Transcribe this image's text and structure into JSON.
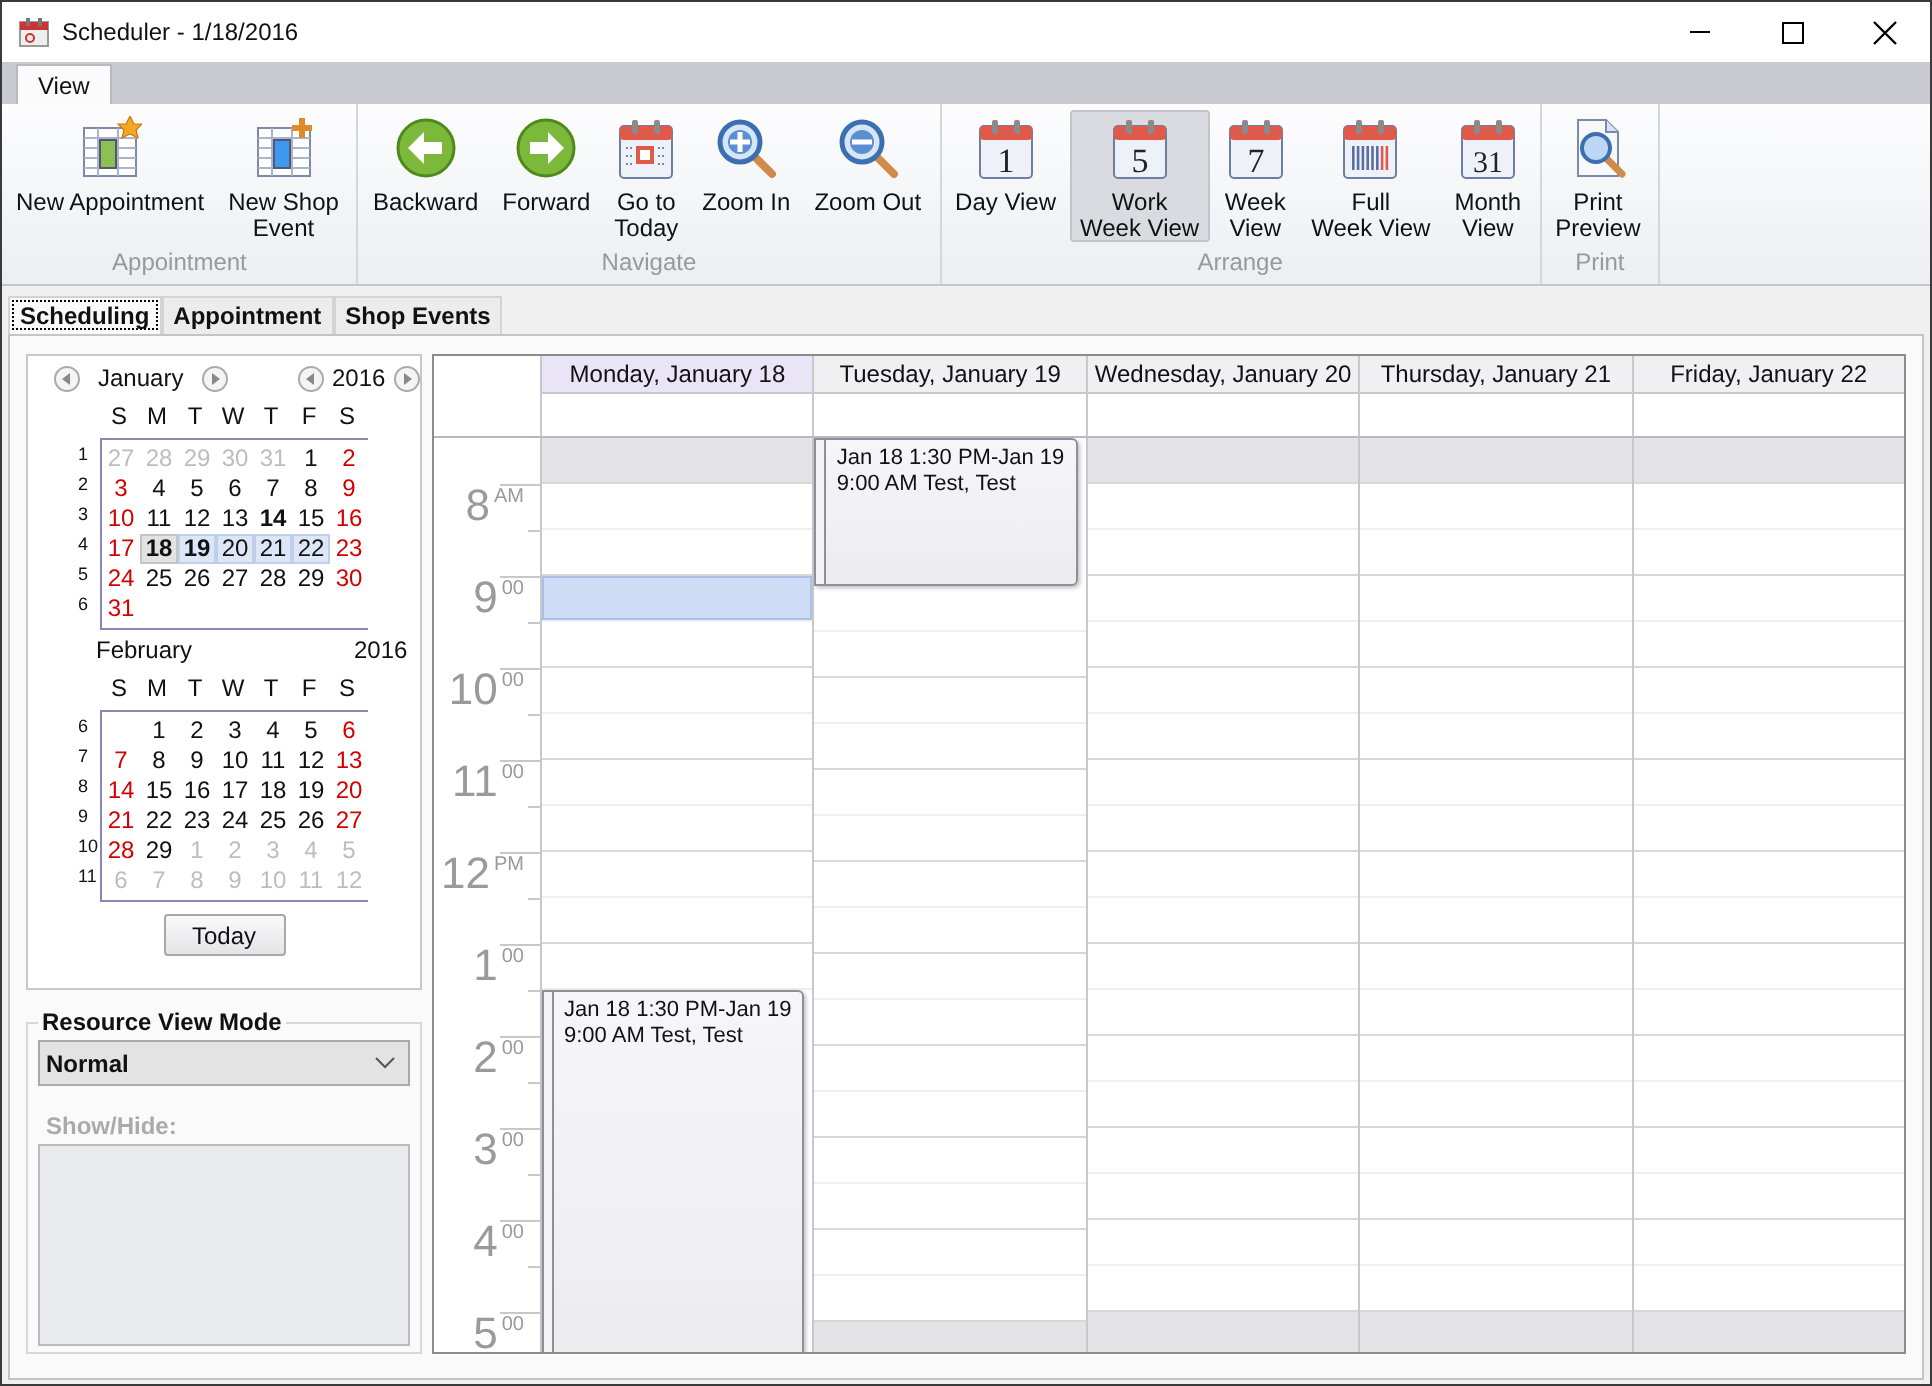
{
  "window": {
    "title": "Scheduler - 1/18/2016"
  },
  "ribbon": {
    "tabs": [
      {
        "label": "View",
        "selected": true
      }
    ],
    "groups": [
      {
        "label": "Appointment",
        "buttons": [
          {
            "label": "New Appointment",
            "kind": "appointment",
            "selected": false
          },
          {
            "label": "New Shop\nEvent",
            "kind": "event",
            "selected": false
          }
        ]
      },
      {
        "label": "Navigate",
        "buttons": [
          {
            "label": "Backward",
            "kind": "backward",
            "selected": false
          },
          {
            "label": "Forward",
            "kind": "forward",
            "selected": false
          },
          {
            "label": "Go to\nToday",
            "kind": "today",
            "selected": false
          },
          {
            "label": "Zoom In",
            "kind": "zoomin",
            "selected": false
          },
          {
            "label": "Zoom Out",
            "kind": "zoomout",
            "selected": false
          }
        ]
      },
      {
        "label": "Arrange",
        "buttons": [
          {
            "label": "Day View",
            "kind": "calendar",
            "icon_text": "1",
            "selected": false
          },
          {
            "label": "Work\nWeek View",
            "kind": "calendar",
            "icon_text": "5",
            "selected": true
          },
          {
            "label": "Week\nView",
            "kind": "calendar",
            "icon_text": "7",
            "selected": false
          },
          {
            "label": "Full\nWeek View",
            "kind": "fullweek",
            "selected": false
          },
          {
            "label": "Month\nView",
            "kind": "calendar",
            "icon_text": "31",
            "selected": false
          }
        ]
      },
      {
        "label": "Print",
        "buttons": [
          {
            "label": "Print\nPreview",
            "kind": "preview",
            "selected": false
          }
        ]
      }
    ]
  },
  "tabs": [
    {
      "label": "Scheduling",
      "selected": true
    },
    {
      "label": "Appointment",
      "selected": false
    },
    {
      "label": "Shop Events",
      "selected": false
    }
  ],
  "calendar": {
    "months": [
      {
        "month": "January",
        "year": "2016",
        "weekdays": [
          "S",
          "M",
          "T",
          "W",
          "T",
          "F",
          "S"
        ],
        "weeks": [
          {
            "number": "1",
            "days": [
              {
                "day": "27",
                "muted": true,
                "bold": false,
                "selected": false,
                "today": false
              },
              {
                "day": "28",
                "muted": true,
                "bold": false,
                "selected": false,
                "today": false
              },
              {
                "day": "29",
                "muted": true,
                "bold": false,
                "selected": false,
                "today": false
              },
              {
                "day": "30",
                "muted": true,
                "bold": false,
                "selected": false,
                "today": false
              },
              {
                "day": "31",
                "muted": true,
                "bold": false,
                "selected": false,
                "today": false
              },
              {
                "day": "1",
                "muted": false,
                "bold": false,
                "selected": false,
                "today": false
              },
              {
                "day": "2",
                "muted": false,
                "bold": false,
                "selected": false,
                "today": false
              }
            ]
          },
          {
            "number": "2",
            "days": [
              {
                "day": "3",
                "muted": false,
                "bold": false,
                "selected": false,
                "today": false
              },
              {
                "day": "4",
                "muted": false,
                "bold": false,
                "selected": false,
                "today": false
              },
              {
                "day": "5",
                "muted": false,
                "bold": false,
                "selected": false,
                "today": false
              },
              {
                "day": "6",
                "muted": false,
                "bold": false,
                "selected": false,
                "today": false
              },
              {
                "day": "7",
                "muted": false,
                "bold": false,
                "selected": false,
                "today": false
              },
              {
                "day": "8",
                "muted": false,
                "bold": false,
                "selected": false,
                "today": false
              },
              {
                "day": "9",
                "muted": false,
                "bold": false,
                "selected": false,
                "today": false
              }
            ]
          },
          {
            "number": "3",
            "days": [
              {
                "day": "10",
                "muted": false,
                "bold": false,
                "selected": false,
                "today": false
              },
              {
                "day": "11",
                "muted": false,
                "bold": false,
                "selected": false,
                "today": false
              },
              {
                "day": "12",
                "muted": false,
                "bold": false,
                "selected": false,
                "today": false
              },
              {
                "day": "13",
                "muted": false,
                "bold": false,
                "selected": false,
                "today": false
              },
              {
                "day": "14",
                "muted": false,
                "bold": true,
                "selected": false,
                "today": false
              },
              {
                "day": "15",
                "muted": false,
                "bold": false,
                "selected": false,
                "today": false
              },
              {
                "day": "16",
                "muted": false,
                "bold": false,
                "selected": false,
                "today": false
              }
            ]
          },
          {
            "number": "4",
            "days": [
              {
                "day": "17",
                "muted": false,
                "bold": false,
                "selected": false,
                "today": false
              },
              {
                "day": "18",
                "muted": false,
                "bold": true,
                "selected": true,
                "today": true
              },
              {
                "day": "19",
                "muted": false,
                "bold": true,
                "selected": true,
                "today": false
              },
              {
                "day": "20",
                "muted": false,
                "bold": false,
                "selected": true,
                "today": false
              },
              {
                "day": "21",
                "muted": false,
                "bold": false,
                "selected": true,
                "today": false
              },
              {
                "day": "22",
                "muted": false,
                "bold": false,
                "selected": true,
                "today": false
              },
              {
                "day": "23",
                "muted": false,
                "bold": false,
                "selected": false,
                "today": false
              }
            ]
          },
          {
            "number": "5",
            "days": [
              {
                "day": "24",
                "muted": false,
                "bold": false,
                "selected": false,
                "today": false
              },
              {
                "day": "25",
                "muted": false,
                "bold": false,
                "selected": false,
                "today": false
              },
              {
                "day": "26",
                "muted": false,
                "bold": false,
                "selected": false,
                "today": false
              },
              {
                "day": "27",
                "muted": false,
                "bold": false,
                "selected": false,
                "today": false
              },
              {
                "day": "28",
                "muted": false,
                "bold": false,
                "selected": false,
                "today": false
              },
              {
                "day": "29",
                "muted": false,
                "bold": false,
                "selected": false,
                "today": false
              },
              {
                "day": "30",
                "muted": false,
                "bold": false,
                "selected": false,
                "today": false
              }
            ]
          },
          {
            "number": "6",
            "days": [
              {
                "day": "31",
                "muted": false,
                "bold": false,
                "selected": false,
                "today": false
              }
            ]
          }
        ]
      },
      {
        "month": "February",
        "year": "2016",
        "weekdays": [
          "S",
          "M",
          "T",
          "W",
          "T",
          "F",
          "S"
        ],
        "weeks": [
          {
            "number": "6",
            "days": [
              {
                "day": "1",
                "muted": false,
                "bold": false,
                "selected": false,
                "today": false
              },
              {
                "day": "2",
                "muted": false,
                "bold": false,
                "selected": false,
                "today": false
              },
              {
                "day": "3",
                "muted": false,
                "bold": false,
                "selected": false,
                "today": false
              },
              {
                "day": "4",
                "muted": false,
                "bold": false,
                "selected": false,
                "today": false
              },
              {
                "day": "5",
                "muted": false,
                "bold": false,
                "selected": false,
                "today": false
              },
              {
                "day": "6",
                "muted": false,
                "bold": false,
                "selected": false,
                "today": false
              }
            ]
          },
          {
            "number": "7",
            "days": [
              {
                "day": "7",
                "muted": false,
                "bold": false,
                "selected": false,
                "today": false
              },
              {
                "day": "8",
                "muted": false,
                "bold": false,
                "selected": false,
                "today": false
              },
              {
                "day": "9",
                "muted": false,
                "bold": false,
                "selected": false,
                "today": false
              },
              {
                "day": "10",
                "muted": false,
                "bold": false,
                "selected": false,
                "today": false
              },
              {
                "day": "11",
                "muted": false,
                "bold": false,
                "selected": false,
                "today": false
              },
              {
                "day": "12",
                "muted": false,
                "bold": false,
                "selected": false,
                "today": false
              },
              {
                "day": "13",
                "muted": false,
                "bold": false,
                "selected": false,
                "today": false
              }
            ]
          },
          {
            "number": "8",
            "days": [
              {
                "day": "14",
                "muted": false,
                "bold": false,
                "selected": false,
                "today": false
              },
              {
                "day": "15",
                "muted": false,
                "bold": false,
                "selected": false,
                "today": false
              },
              {
                "day": "16",
                "muted": false,
                "bold": false,
                "selected": false,
                "today": false
              },
              {
                "day": "17",
                "muted": false,
                "bold": false,
                "selected": false,
                "today": false
              },
              {
                "day": "18",
                "muted": false,
                "bold": false,
                "selected": false,
                "today": false
              },
              {
                "day": "19",
                "muted": false,
                "bold": false,
                "selected": false,
                "today": false
              },
              {
                "day": "20",
                "muted": false,
                "bold": false,
                "selected": false,
                "today": false
              }
            ]
          },
          {
            "number": "9",
            "days": [
              {
                "day": "21",
                "muted": false,
                "bold": false,
                "selected": false,
                "today": false
              },
              {
                "day": "22",
                "muted": false,
                "bold": false,
                "selected": false,
                "today": false
              },
              {
                "day": "23",
                "muted": false,
                "bold": false,
                "selected": false,
                "today": false
              },
              {
                "day": "24",
                "muted": false,
                "bold": false,
                "selected": false,
                "today": false
              },
              {
                "day": "25",
                "muted": false,
                "bold": false,
                "selected": false,
                "today": false
              },
              {
                "day": "26",
                "muted": false,
                "bold": false,
                "selected": false,
                "today": false
              },
              {
                "day": "27",
                "muted": false,
                "bold": false,
                "selected": false,
                "today": false
              }
            ]
          },
          {
            "number": "10",
            "days": [
              {
                "day": "28",
                "muted": false,
                "bold": false,
                "selected": false,
                "today": false
              },
              {
                "day": "29",
                "muted": false,
                "bold": false,
                "selected": false,
                "today": false
              },
              {
                "day": "1",
                "muted": true,
                "bold": false,
                "selected": false,
                "today": false
              },
              {
                "day": "2",
                "muted": true,
                "bold": false,
                "selected": false,
                "today": false
              },
              {
                "day": "3",
                "muted": true,
                "bold": false,
                "selected": false,
                "today": false
              },
              {
                "day": "4",
                "muted": true,
                "bold": false,
                "selected": false,
                "today": false
              },
              {
                "day": "5",
                "muted": true,
                "bold": false,
                "selected": false,
                "today": false
              }
            ]
          },
          {
            "number": "11",
            "days": [
              {
                "day": "6",
                "muted": true,
                "bold": false,
                "selected": false,
                "today": false
              },
              {
                "day": "7",
                "muted": true,
                "bold": false,
                "selected": false,
                "today": false
              },
              {
                "day": "8",
                "muted": true,
                "bold": false,
                "selected": false,
                "today": false
              },
              {
                "day": "9",
                "muted": true,
                "bold": false,
                "selected": false,
                "today": false
              },
              {
                "day": "10",
                "muted": true,
                "bold": false,
                "selected": false,
                "today": false
              },
              {
                "day": "11",
                "muted": true,
                "bold": false,
                "selected": false,
                "today": false
              },
              {
                "day": "12",
                "muted": true,
                "bold": false,
                "selected": false,
                "today": false
              }
            ]
          }
        ]
      }
    ],
    "today_button": "Today"
  },
  "resource": {
    "title": "Resource View Mode",
    "value": "Normal",
    "show_hide_label": "Show/Hide:",
    "show_hide_disabled": true
  },
  "scheduler": {
    "rows": [
      {
        "working": false
      },
      {
        "working": true
      },
      {
        "working": true
      },
      {
        "working": true
      },
      {
        "working": true
      },
      {
        "working": true
      },
      {
        "working": true
      },
      {
        "working": true
      },
      {
        "working": true
      },
      {
        "working": true
      },
      {
        "working": true
      },
      {
        "working": true
      },
      {
        "working": true
      },
      {
        "working": true
      },
      {
        "working": true
      },
      {
        "working": true
      },
      {
        "working": true
      },
      {
        "working": true
      },
      {
        "working": true
      },
      {
        "working": false
      }
    ],
    "time_labels": [
      {
        "hour": "8",
        "suffix": "AM"
      },
      {
        "hour": "9",
        "suffix": "00"
      },
      {
        "hour": "10",
        "suffix": "00"
      },
      {
        "hour": "11",
        "suffix": "00"
      },
      {
        "hour": "12",
        "suffix": "PM"
      },
      {
        "hour": "1",
        "suffix": "00"
      },
      {
        "hour": "2",
        "suffix": "00"
      },
      {
        "hour": "3",
        "suffix": "00"
      },
      {
        "hour": "4",
        "suffix": "00"
      },
      {
        "hour": "5",
        "suffix": "00"
      }
    ],
    "days": [
      {
        "label": "Monday, January 18",
        "selected": true,
        "appointment": "Jan 18 1:30 PM-Jan 19 9:00 AM Test, Test",
        "slots": [
          {
            "kind": "free",
            "selected": false
          },
          {
            "kind": "free",
            "selected": false
          },
          {
            "kind": "free",
            "selected": false
          },
          {
            "kind": "free",
            "selected": true
          },
          {
            "kind": "free",
            "selected": false
          },
          {
            "kind": "free",
            "selected": false
          },
          {
            "kind": "free",
            "selected": false
          },
          {
            "kind": "free",
            "selected": false
          },
          {
            "kind": "free",
            "selected": false
          },
          {
            "kind": "free",
            "selected": false
          },
          {
            "kind": "free",
            "selected": false
          },
          {
            "kind": "free",
            "selected": false
          },
          {
            "kind": "busy"
          },
          {
            "kind": "busy"
          },
          {
            "kind": "busy"
          },
          {
            "kind": "busy"
          },
          {
            "kind": "busy"
          },
          {
            "kind": "busy"
          },
          {
            "kind": "busy"
          },
          {
            "kind": "busy"
          }
        ]
      },
      {
        "label": "Tuesday, January 19",
        "selected": false,
        "appointment": "Jan 18 1:30 PM-Jan 19 9:00 AM Test, Test",
        "slots": [
          {
            "kind": "busy"
          },
          {
            "kind": "busy"
          },
          {
            "kind": "busy"
          },
          {
            "kind": "free",
            "selected": false
          },
          {
            "kind": "free",
            "selected": false
          },
          {
            "kind": "free",
            "selected": false
          },
          {
            "kind": "free",
            "selected": false
          },
          {
            "kind": "free",
            "selected": false
          },
          {
            "kind": "free",
            "selected": false
          },
          {
            "kind": "free",
            "selected": false
          },
          {
            "kind": "free",
            "selected": false
          },
          {
            "kind": "free",
            "selected": false
          },
          {
            "kind": "free",
            "selected": false
          },
          {
            "kind": "free",
            "selected": false
          },
          {
            "kind": "free",
            "selected": false
          },
          {
            "kind": "free",
            "selected": false
          },
          {
            "kind": "free",
            "selected": false
          },
          {
            "kind": "free",
            "selected": false
          },
          {
            "kind": "free",
            "selected": false
          },
          {
            "kind": "free",
            "selected": false
          }
        ]
      },
      {
        "label": "Wednesday, January 20",
        "selected": false,
        "slots": [
          {
            "kind": "free",
            "selected": false
          },
          {
            "kind": "free",
            "selected": false
          },
          {
            "kind": "free",
            "selected": false
          },
          {
            "kind": "free",
            "selected": false
          },
          {
            "kind": "free",
            "selected": false
          },
          {
            "kind": "free",
            "selected": false
          },
          {
            "kind": "free",
            "selected": false
          },
          {
            "kind": "free",
            "selected": false
          },
          {
            "kind": "free",
            "selected": false
          },
          {
            "kind": "free",
            "selected": false
          },
          {
            "kind": "free",
            "selected": false
          },
          {
            "kind": "free",
            "selected": false
          },
          {
            "kind": "free",
            "selected": false
          },
          {
            "kind": "free",
            "selected": false
          },
          {
            "kind": "free",
            "selected": false
          },
          {
            "kind": "free",
            "selected": false
          },
          {
            "kind": "free",
            "selected": false
          },
          {
            "kind": "free",
            "selected": false
          },
          {
            "kind": "free",
            "selected": false
          },
          {
            "kind": "free",
            "selected": false
          }
        ]
      },
      {
        "label": "Thursday, January 21",
        "selected": false,
        "slots": [
          {
            "kind": "free",
            "selected": false
          },
          {
            "kind": "free",
            "selected": false
          },
          {
            "kind": "free",
            "selected": false
          },
          {
            "kind": "free",
            "selected": false
          },
          {
            "kind": "free",
            "selected": false
          },
          {
            "kind": "free",
            "selected": false
          },
          {
            "kind": "free",
            "selected": false
          },
          {
            "kind": "free",
            "selected": false
          },
          {
            "kind": "free",
            "selected": false
          },
          {
            "kind": "free",
            "selected": false
          },
          {
            "kind": "free",
            "selected": false
          },
          {
            "kind": "free",
            "selected": false
          },
          {
            "kind": "free",
            "selected": false
          },
          {
            "kind": "free",
            "selected": false
          },
          {
            "kind": "free",
            "selected": false
          },
          {
            "kind": "free",
            "selected": false
          },
          {
            "kind": "free",
            "selected": false
          },
          {
            "kind": "free",
            "selected": false
          },
          {
            "kind": "free",
            "selected": false
          },
          {
            "kind": "free",
            "selected": false
          }
        ]
      },
      {
        "label": "Friday, January 22",
        "selected": false,
        "slots": [
          {
            "kind": "free",
            "selected": false
          },
          {
            "kind": "free",
            "selected": false
          },
          {
            "kind": "free",
            "selected": false
          },
          {
            "kind": "free",
            "selected": false
          },
          {
            "kind": "free",
            "selected": false
          },
          {
            "kind": "free",
            "selected": false
          },
          {
            "kind": "free",
            "selected": false
          },
          {
            "kind": "free",
            "selected": false
          },
          {
            "kind": "free",
            "selected": false
          },
          {
            "kind": "free",
            "selected": false
          },
          {
            "kind": "free",
            "selected": false
          },
          {
            "kind": "free",
            "selected": false
          },
          {
            "kind": "free",
            "selected": false
          },
          {
            "kind": "free",
            "selected": false
          },
          {
            "kind": "free",
            "selected": false
          },
          {
            "kind": "free",
            "selected": false
          },
          {
            "kind": "free",
            "selected": false
          },
          {
            "kind": "free",
            "selected": false
          },
          {
            "kind": "free",
            "selected": false
          },
          {
            "kind": "free",
            "selected": false
          }
        ]
      }
    ]
  }
}
